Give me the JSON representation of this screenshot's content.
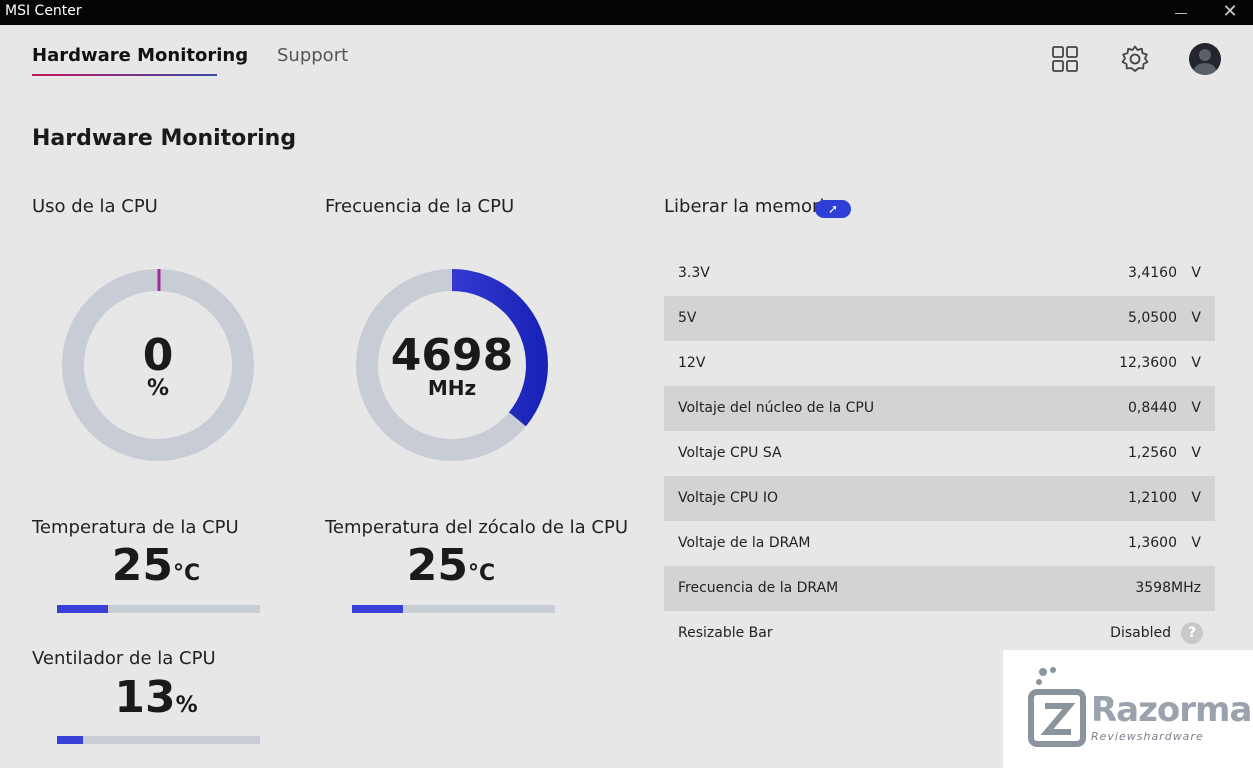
{
  "window": {
    "title": "MSI Center"
  },
  "tabs": [
    {
      "label": "Hardware Monitoring",
      "active": true
    },
    {
      "label": "Support",
      "active": false
    }
  ],
  "page_title": "Hardware Monitoring",
  "cpu_usage": {
    "label": "Uso de la CPU",
    "value": "0",
    "unit": "%",
    "fraction": 0.0
  },
  "cpu_frequency": {
    "label": "Frecuencia de la CPU",
    "value": "4698",
    "unit": "MHz",
    "fraction": 0.36
  },
  "cpu_temp": {
    "label": "Temperatura de la CPU",
    "value": "25",
    "unit": "°C",
    "fraction": 0.25
  },
  "socket_temp": {
    "label": "Temperatura del zócalo de la CPU",
    "value": "25",
    "unit": "°C",
    "fraction": 0.25
  },
  "cpu_fan": {
    "label": "Ventilador de la CPU",
    "value": "13",
    "unit": "%",
    "fraction": 0.13
  },
  "memory": {
    "label": "Liberar la memoria"
  },
  "voltages": [
    {
      "name": "3.3V",
      "value": "3,4160",
      "unit": "V"
    },
    {
      "name": "5V",
      "value": "5,0500",
      "unit": "V"
    },
    {
      "name": "12V",
      "value": "12,3600",
      "unit": "V"
    },
    {
      "name": "Voltaje del núcleo de la CPU",
      "value": "0,8440",
      "unit": "V"
    },
    {
      "name": "Voltaje CPU SA",
      "value": "1,2560",
      "unit": "V"
    },
    {
      "name": "Voltaje CPU IO",
      "value": "1,2100",
      "unit": "V"
    },
    {
      "name": "Voltaje de la DRAM",
      "value": "1,3600",
      "unit": "V"
    },
    {
      "name": "Frecuencia de la DRAM",
      "value": "3598",
      "unit": "MHz"
    },
    {
      "name": "Resizable Bar",
      "value": "Disabled",
      "unit": ""
    }
  ],
  "watermark": {
    "name": "Razorman",
    "tagline": "Reviewshardware"
  },
  "colors": {
    "accent_blue": "#3a3fd8",
    "accent_magenta": "#b0309a",
    "track": "#c8ccd4"
  },
  "icons": [
    "close-icon",
    "minimize-icon",
    "grid-icon",
    "gear-icon",
    "avatar-icon",
    "arrow-up-icon",
    "help-icon"
  ]
}
